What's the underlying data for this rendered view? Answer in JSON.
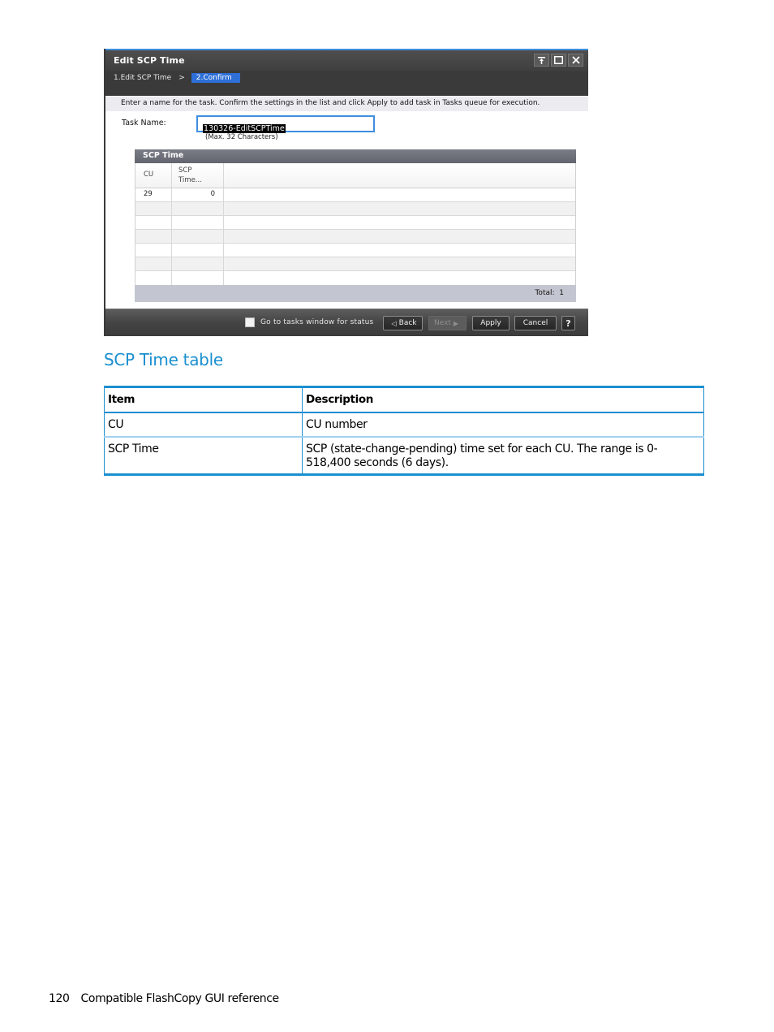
{
  "dialog": {
    "title": "Edit SCP Time",
    "window_buttons": [
      "pin-icon",
      "maximize-icon",
      "close-icon"
    ],
    "steps": [
      {
        "label": "1.Edit SCP Time",
        "active": false
      },
      {
        "label": "2.Confirm",
        "active": true
      }
    ],
    "step_separator": ">",
    "instruction": "Enter a name for the task. Confirm the settings in the list and click Apply to add task in Tasks queue for execution.",
    "task_name": {
      "label": "Task Name:",
      "value": "130326-EditSCPTime",
      "hint": "(Max. 32 Characters)"
    },
    "grid": {
      "title": "SCP Time",
      "columns": [
        "CU",
        "SCP Time..."
      ],
      "rows": [
        {
          "cu": "29",
          "scp_time": "0"
        }
      ],
      "empty_rows": 7,
      "total_label": "Total:",
      "total_value": "1"
    },
    "footer": {
      "checkbox_label": "Go to tasks window for status",
      "checkbox_checked": false,
      "back_label": "Back",
      "next_label": "Next",
      "apply_label": "Apply",
      "cancel_label": "Cancel",
      "help_label": "?"
    }
  },
  "section": {
    "title": "SCP Time table"
  },
  "table": {
    "headers": [
      "Item",
      "Description"
    ],
    "rows": [
      {
        "item": "CU",
        "description": "CU number"
      },
      {
        "item": "SCP Time",
        "description": "SCP (state-change-pending) time set for each CU. The range is 0-518,400 seconds (6 days)."
      }
    ]
  },
  "page_footer": {
    "page_number": "120",
    "text": "Compatible FlashCopy GUI reference"
  },
  "colors": {
    "accent_blue": "#1a8fd0",
    "dialog_header": "#3f3f3f",
    "active_step": "#2e6fd8"
  }
}
